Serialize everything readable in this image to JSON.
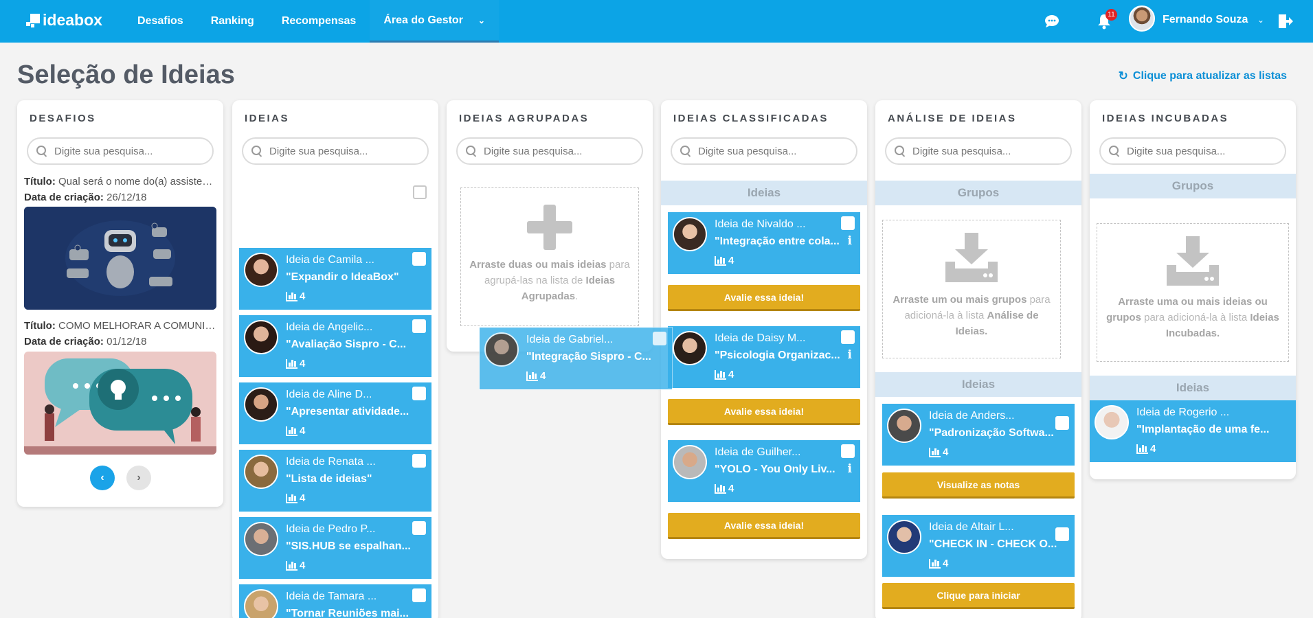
{
  "app": {
    "logo_text": "ideabox"
  },
  "nav": {
    "items": [
      {
        "label": "Desafios"
      },
      {
        "label": "Ranking"
      },
      {
        "label": "Recompensas"
      },
      {
        "label": "Área do Gestor"
      }
    ]
  },
  "user": {
    "name": "Fernando Souza",
    "notifications": "11"
  },
  "page": {
    "title": "Seleção de Ideias",
    "refresh_label": "Clique para atualizar as listas"
  },
  "search_placeholder": "Digite sua pesquisa...",
  "columns": {
    "desafios": {
      "title": "DESAFIOS",
      "items": [
        {
          "label_title": "Título:",
          "title": "Qual será o nome do(a) assistente virtual?",
          "label_date": "Data de criação:",
          "date": "26/12/18"
        },
        {
          "label_title": "Título:",
          "title": "COMO MELHORAR A COMUNICAÇÃO",
          "label_date": "Data de criação:",
          "date": "01/12/18"
        }
      ]
    },
    "ideias": {
      "title": "IDEIAS",
      "cards": [
        {
          "who": "Ideia de Camila ...",
          "title": "\"Expandir o IdeaBox\"",
          "score": "4"
        },
        {
          "who": "Ideia de Angelic...",
          "title": "\"Avaliação Sispro - C...",
          "score": "4"
        },
        {
          "who": "Ideia de Aline D...",
          "title": "\"Apresentar atividade...",
          "score": "4"
        },
        {
          "who": "Ideia de Renata ...",
          "title": "\"Lista de ideias\"",
          "score": "4"
        },
        {
          "who": "Ideia de Pedro P...",
          "title": "\"SIS.HUB se espalhan...",
          "score": "4"
        },
        {
          "who": "Ideia de Tamara ...",
          "title": "\"Tornar Reuniões mai...",
          "score": "4"
        }
      ]
    },
    "agrupadas": {
      "title": "IDEIAS AGRUPADAS",
      "drop_bold1": "Arraste duas ou mais ideias",
      "drop_text1": " para agrupá-las na lista de ",
      "drop_bold2": "Ideias Agrupadas",
      "drop_text2": "."
    },
    "classificadas": {
      "title": "IDEIAS CLASSIFICADAS",
      "section": "Ideias",
      "cards": [
        {
          "who": "Ideia de Nivaldo ...",
          "title": "\"Integração entre cola...",
          "score": "4",
          "button": "Avalie essa ideia!"
        },
        {
          "who": "Ideia de Daisy M...",
          "title": "\"Psicologia Organizac...",
          "score": "4",
          "button": "Avalie essa ideia!"
        },
        {
          "who": "Ideia de Guilher...",
          "title": "\"YOLO - You Only Liv...",
          "score": "4",
          "button": "Avalie essa ideia!"
        }
      ]
    },
    "analise": {
      "title": "ANÁLISE DE IDEIAS",
      "section_groups": "Grupos",
      "drop_bold1": "Arraste um ou mais grupos",
      "drop_text1": " para adicioná-la à lista ",
      "drop_bold2": "Análise de Ideias.",
      "section_ideas": "Ideias",
      "cards": [
        {
          "who": "Ideia de Anders...",
          "title": "\"Padronização Softwa...",
          "score": "4",
          "button": "Visualize as notas"
        },
        {
          "who": "Ideia de Altair L...",
          "title": "\"CHECK IN - CHECK O...",
          "score": "4",
          "button": "Clique para iniciar"
        }
      ]
    },
    "incubadas": {
      "title": "IDEIAS INCUBADAS",
      "section_groups": "Grupos",
      "drop_bold1": "Arraste uma ou mais ideias ou grupos",
      "drop_text1": " para adicioná-la à lista ",
      "drop_bold2": "Ideias Incubadas.",
      "section_ideas": "Ideias",
      "cards": [
        {
          "who": "Ideia de Rogerio ...",
          "title": "\"Implantação de uma fe...",
          "score": "4"
        }
      ]
    }
  },
  "dragging": {
    "who": "Ideia de Gabriel...",
    "title": "\"Integração Sispro - C...",
    "score": "4"
  },
  "colors": {
    "topbar": "#0ca4e6",
    "card": "#39b1ea",
    "button": "#e2ac1f"
  }
}
